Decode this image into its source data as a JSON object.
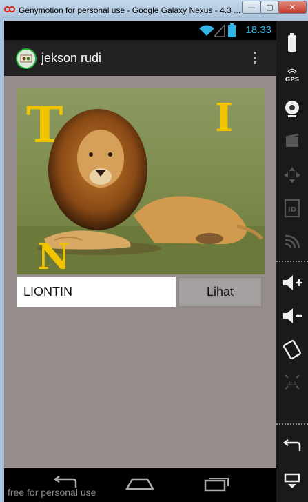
{
  "window": {
    "title": "Genymotion for personal use - Google Galaxy Nexus - 4.3 ...",
    "min_label": "—",
    "max_label": "▢",
    "close_label": "✕"
  },
  "statusbar": {
    "time": "18.33"
  },
  "actionbar": {
    "title": "jekson rudi"
  },
  "image": {
    "letters": [
      "T",
      "I",
      "N"
    ]
  },
  "form": {
    "input_value": "LIONTIN",
    "button_label": "Lihat"
  },
  "watermark": "free for personal use",
  "sidebar": {
    "gps_label": "GPS",
    "id_label": "ID",
    "scale_label": "1:1"
  },
  "colors": {
    "status_accent": "#33b5e5",
    "content_bg": "#968c8c",
    "letter_color": "#f2c400"
  }
}
